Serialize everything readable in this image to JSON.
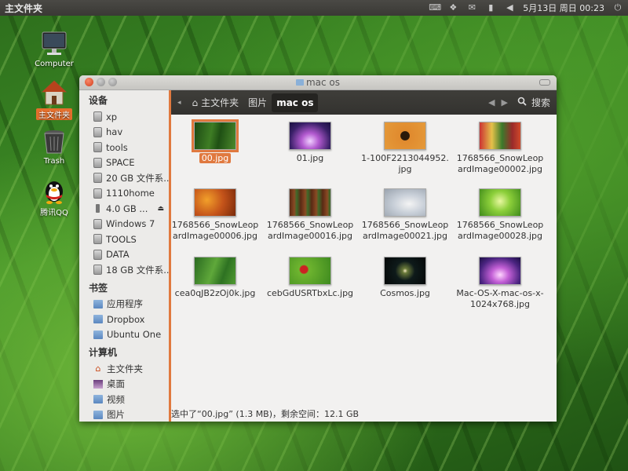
{
  "panel": {
    "title": "主文件夹",
    "clock": "5月13日 周日 00:23",
    "tray_icons": [
      "keyboard-icon",
      "dropbox-icon",
      "mail-icon",
      "network-icon",
      "volume-icon"
    ]
  },
  "desktop": {
    "icons": [
      {
        "label": "Computer",
        "icon": "computer-icon",
        "selected": false
      },
      {
        "label": "主文件夹",
        "icon": "home-folder-icon",
        "selected": true
      },
      {
        "label": "Trash",
        "icon": "trash-icon",
        "selected": false
      },
      {
        "label": "腾讯QQ",
        "icon": "qq-icon",
        "selected": false
      }
    ]
  },
  "window": {
    "title": "mac os",
    "sidebar": {
      "devices_header": "设备",
      "devices": [
        "xp",
        "hav",
        "tools",
        "SPACE",
        "20 GB 文件系...",
        "1110home",
        "4.0 GB ...",
        "Windows 7",
        "TOOLS",
        "DATA",
        "18 GB 文件系..."
      ],
      "bookmarks_header": "书签",
      "bookmarks": [
        "应用程序",
        "Dropbox",
        "Ubuntu One"
      ],
      "computer_header": "计算机",
      "computer": [
        "主文件夹",
        "桌面",
        "视频",
        "图片"
      ]
    },
    "toolbar": {
      "crumbs": [
        "主文件夹",
        "图片",
        "mac os"
      ],
      "search_label": "搜索"
    },
    "files": [
      {
        "name": "00.jpg",
        "selected": true
      },
      {
        "name": "01.jpg",
        "selected": false
      },
      {
        "name": "1-100F2213044952.jpg",
        "selected": false
      },
      {
        "name": "1768566_SnowLeopardImage00002.jpg",
        "selected": false
      },
      {
        "name": "1768566_SnowLeopardImage00006.jpg",
        "selected": false
      },
      {
        "name": "1768566_SnowLeopardImage00016.jpg",
        "selected": false
      },
      {
        "name": "1768566_SnowLeopardImage00021.jpg",
        "selected": false
      },
      {
        "name": "1768566_SnowLeopardImage00028.jpg",
        "selected": false
      },
      {
        "name": "cea0qJB2zOj0k.jpg",
        "selected": false
      },
      {
        "name": "cebGdUSRTbxLc.jpg",
        "selected": false
      },
      {
        "name": "Cosmos.jpg",
        "selected": false
      },
      {
        "name": "Mac-OS-X-mac-os-x-1024x768.jpg",
        "selected": false
      }
    ],
    "status": "选中了“00.jpg” (1.3 MB)，剩余空间：12.1 GB"
  },
  "colors": {
    "accent": "#e0793f",
    "panel_bg": "#3c3b37",
    "sidebar_bg": "#ecebe9",
    "window_bg": "#f2f1f0"
  }
}
